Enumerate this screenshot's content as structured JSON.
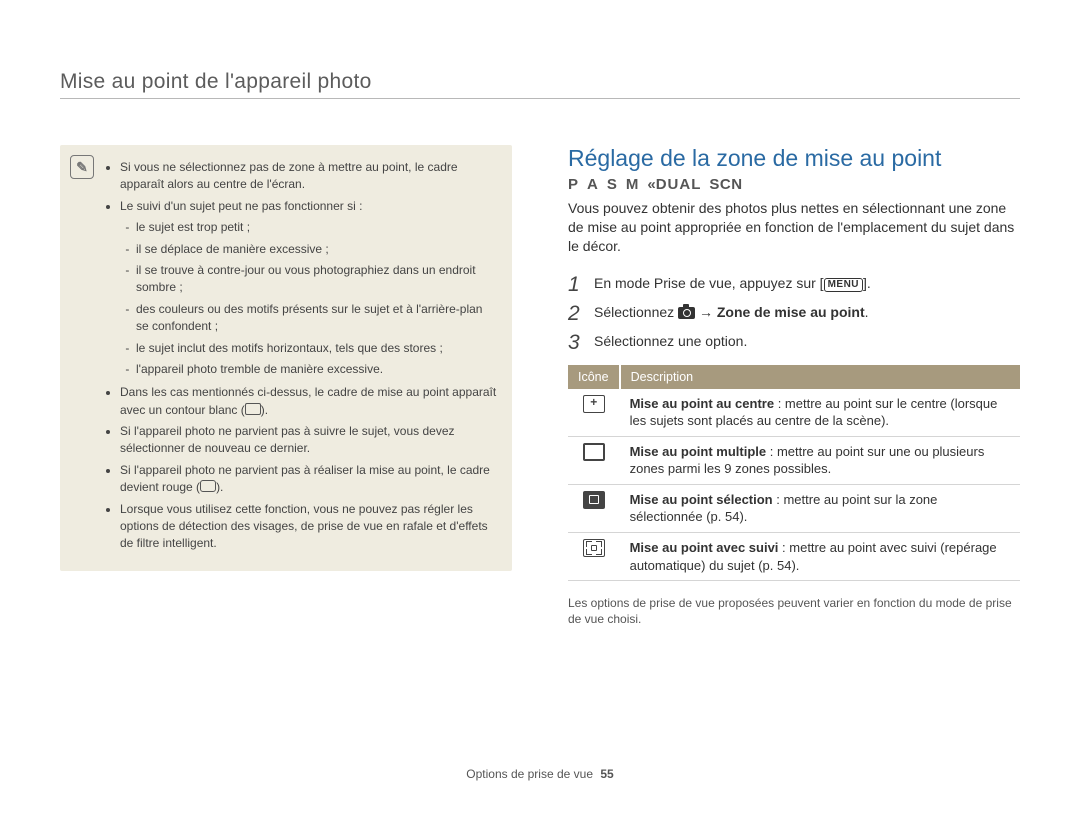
{
  "header_title": "Mise au point de l'appareil photo",
  "note": {
    "items": [
      {
        "text": "Si vous ne sélectionnez pas de zone à mettre au point, le cadre apparaît alors au centre de l'écran."
      },
      {
        "text": "Le suivi d'un sujet peut ne pas fonctionner si :",
        "sub": [
          "le sujet est trop petit ;",
          "il se déplace de manière excessive ;",
          "il se trouve à contre-jour ou vous photographiez dans un endroit sombre ;",
          "des couleurs ou des motifs présents sur le sujet et à l'arrière-plan se confondent ;",
          "le sujet inclut des motifs horizontaux, tels que des stores ;",
          "l'appareil photo tremble de manière excessive."
        ]
      },
      {
        "text_parts": {
          "a": "Dans les cas mentionnés ci-dessus, le cadre de mise au point apparaît avec un contour blanc (",
          "b": ")."
        }
      },
      {
        "text": "Si l'appareil photo ne parvient pas à suivre le sujet, vous devez sélectionner de nouveau ce dernier."
      },
      {
        "text_parts": {
          "a": "Si l'appareil photo ne parvient pas à réaliser la mise au point, le cadre devient rouge (",
          "b": ")."
        }
      },
      {
        "text": "Lorsque vous utilisez cette fonction, vous ne pouvez pas régler les options de détection des visages, de prise de vue en rafale et d'effets de filtre intelligent."
      }
    ]
  },
  "section": {
    "title": "Réglage de la zone de mise au point",
    "modes": {
      "p": "P",
      "a": "A",
      "s": "S",
      "m": "M",
      "dual": "DUAL",
      "scn": "SCN"
    },
    "intro": "Vous pouvez obtenir des photos plus nettes en sélectionnant une zone de mise au point appropriée en fonction de l'emplacement du sujet dans le décor.",
    "steps": {
      "s1_pre": "En mode Prise de vue, appuyez sur [",
      "s1_menu": "MENU",
      "s1_post": "].",
      "s2_pre": "Sélectionnez ",
      "s2_arrow": " → ",
      "s2_bold": "Zone de mise au point",
      "s2_post": ".",
      "s3": "Sélectionnez une option."
    },
    "table": {
      "head_icon": "Icône",
      "head_desc": "Description",
      "rows": [
        {
          "bold": "Mise au point au centre",
          "text": " : mettre au point sur le centre (lorsque les sujets sont placés au centre de la scène)."
        },
        {
          "bold": "Mise au point multiple",
          "text": " : mettre au point sur une ou plusieurs zones parmi les 9 zones possibles."
        },
        {
          "bold": "Mise au point sélection",
          "text": " : mettre au point sur la zone sélectionnée (p. 54)."
        },
        {
          "bold": "Mise au point avec suivi",
          "text": " : mettre au point avec suivi (repérage automatique) du sujet (p. 54)."
        }
      ]
    },
    "footnote": "Les options de prise de vue proposées peuvent varier en fonction du mode de prise de vue choisi."
  },
  "footer": {
    "label": "Options de prise de vue",
    "page": "55"
  }
}
